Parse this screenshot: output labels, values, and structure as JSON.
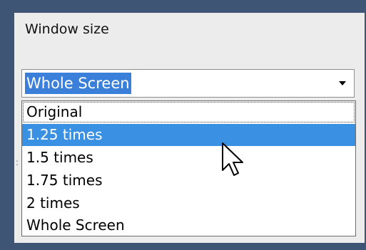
{
  "window_size": {
    "label": "Window size",
    "selected_value": "Whole Screen",
    "options": [
      "Original",
      "1.25 times",
      "1.5 times",
      "1.75 times",
      "2 times",
      "Whole Screen"
    ],
    "highlighted_index": 1
  },
  "icons": {
    "dropdown": "chevron-down-icon",
    "pointer": "mouse-pointer-icon"
  },
  "colors": {
    "selection": "#3a90e3",
    "background": "#3f5576"
  }
}
